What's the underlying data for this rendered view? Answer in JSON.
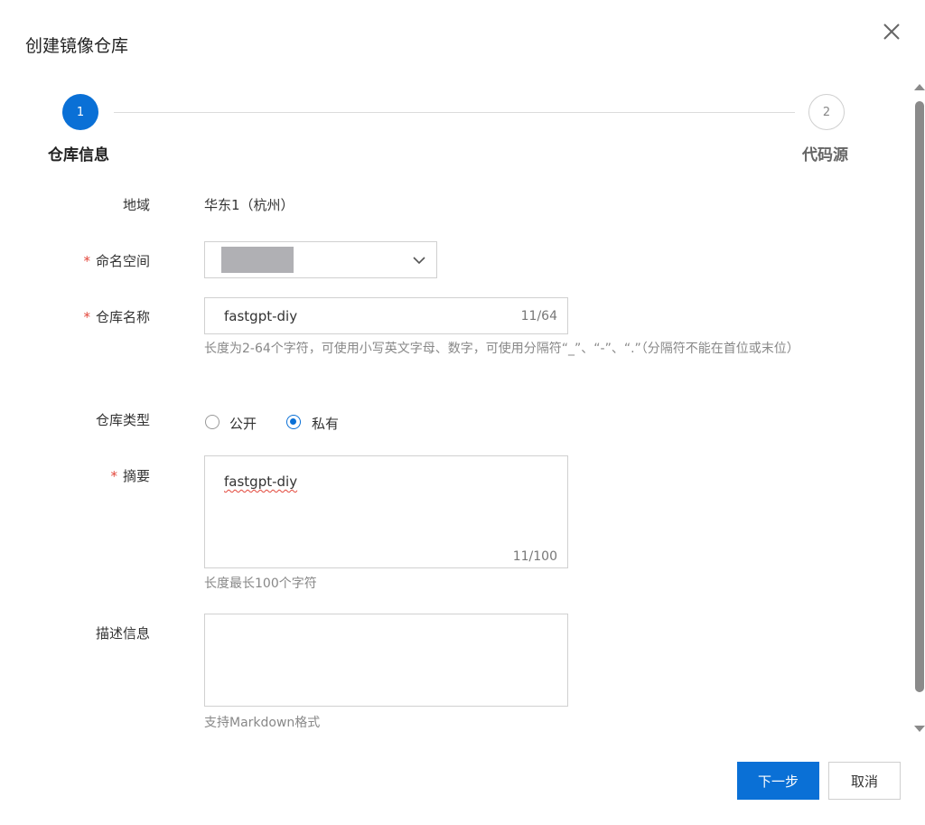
{
  "dialog": {
    "title": "创建镜像仓库",
    "close_icon": "close-icon"
  },
  "steps": [
    {
      "number": "1",
      "label": "仓库信息",
      "active": true
    },
    {
      "number": "2",
      "label": "代码源",
      "active": false
    }
  ],
  "form": {
    "region": {
      "label": "地域",
      "value": "华东1（杭州）"
    },
    "namespace": {
      "label": "命名空间",
      "required": true,
      "value": "",
      "redacted": true
    },
    "repo_name": {
      "label": "仓库名称",
      "required": true,
      "value": "fastgpt-diy",
      "counter": "11/64",
      "help": "长度为2-64个字符，可使用小写英文字母、数字，可使用分隔符“_”、“-”、“.”（分隔符不能在首位或末位）"
    },
    "repo_type": {
      "label": "仓库类型",
      "options": [
        {
          "label": "公开",
          "checked": false
        },
        {
          "label": "私有",
          "checked": true
        }
      ]
    },
    "summary": {
      "label": "摘要",
      "required": true,
      "value": "fastgpt-diy",
      "counter": "11/100",
      "help": "长度最长100个字符"
    },
    "description": {
      "label": "描述信息",
      "value": "",
      "help": "支持Markdown格式"
    }
  },
  "footer": {
    "next_label": "下一步",
    "cancel_label": "取消"
  },
  "colors": {
    "primary": "#0a70d6",
    "required": "#e2463a",
    "border": "#d0d0d0"
  }
}
